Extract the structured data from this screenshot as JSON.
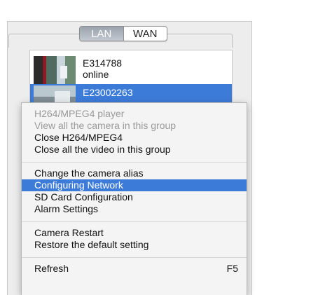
{
  "tabs": [
    {
      "label": "LAN",
      "selected": true
    },
    {
      "label": "WAN",
      "selected": false
    }
  ],
  "cameras": [
    {
      "name": "E314788",
      "status": "online",
      "selected": false
    },
    {
      "name": "E23002263",
      "status": "",
      "selected": true
    }
  ],
  "menu": {
    "group1": [
      {
        "label": "H264/MPEG4 player",
        "enabled": false
      },
      {
        "label": "View all the camera in this group",
        "enabled": false
      },
      {
        "label": "Close H264/MPEG4",
        "enabled": true
      },
      {
        "label": "Close all the video in this group",
        "enabled": true
      }
    ],
    "group2": [
      {
        "label": "Change the camera alias",
        "enabled": true
      },
      {
        "label": "Configuring Network",
        "enabled": true,
        "highlighted": true
      },
      {
        "label": "SD Card Configuration",
        "enabled": true
      },
      {
        "label": "Alarm Settings",
        "enabled": true
      }
    ],
    "group3": [
      {
        "label": "Camera Restart",
        "enabled": true
      },
      {
        "label": "Restore the default setting",
        "enabled": true
      }
    ],
    "group4": [
      {
        "label": "Refresh",
        "shortcut": "F5",
        "enabled": true
      }
    ]
  },
  "colors": {
    "selection": "#3d7bd9",
    "panel": "#ededed",
    "menu_bg": "#f4f4f4",
    "disabled_text": "#9a9a9a"
  }
}
